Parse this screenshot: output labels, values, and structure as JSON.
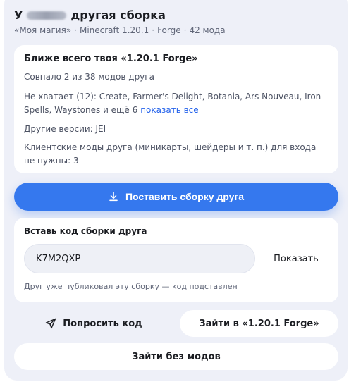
{
  "header": {
    "title_prefix": "У",
    "title_suffix": "другая сборка",
    "subtitle_pack": "«Моя магия»",
    "subtitle_version": "Minecraft 1.20.1",
    "subtitle_loader": "Forge",
    "subtitle_mods": "42 мода",
    "separator": "·"
  },
  "match": {
    "heading": "Ближе всего твоя «1.20.1 Forge»",
    "matched": "Совпало 2 из 38 модов друга",
    "missing": "Не хватает (12): Create, Farmer's Delight, Botania, Ars Nouveau, Iron Spells, Waystones и ещё 6",
    "show_all": "показать все",
    "other_versions": "Другие версии: JEI",
    "client_mods": "Клиентские моды друга (миникарты, шейдеры и т. п.) для входа не нужны: 3"
  },
  "install": {
    "label": "Поставить сборку друга",
    "icon": "download-icon"
  },
  "code": {
    "label": "Вставь код сборки друга",
    "value": "K7M2QXP",
    "show_label": "Показать",
    "hint": "Друг уже публиковал эту сборку — код подставлен"
  },
  "actions": {
    "ask_code": "Попросить код",
    "ask_icon": "send-icon",
    "join": "Зайти в «1.20.1 Forge»",
    "no_mods": "Зайти без модов"
  },
  "colors": {
    "accent": "#3578ee",
    "link": "#2563eb",
    "panel": "#eef0f8"
  }
}
